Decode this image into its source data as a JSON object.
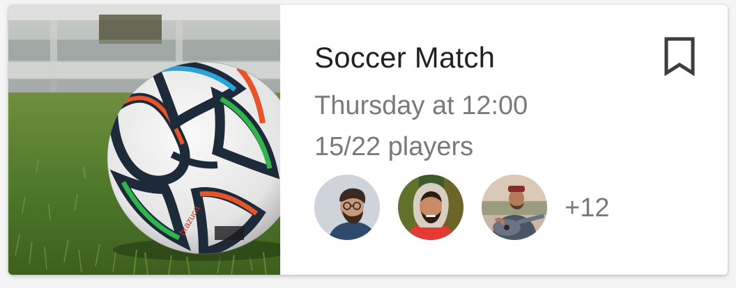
{
  "event": {
    "title": "Soccer Match",
    "when": "Thursday at 12:00",
    "players": "15/22 players",
    "more_count": "+12"
  },
  "image": {
    "subject": "soccer-ball-on-grass"
  },
  "attendees": [
    {
      "icon": "person-glasses-avatar"
    },
    {
      "icon": "person-hood-avatar"
    },
    {
      "icon": "person-guitar-avatar"
    }
  ],
  "icons": {
    "bookmark": "bookmark-icon"
  },
  "colors": {
    "title": "#212121",
    "secondary": "#7a7a7a",
    "card": "#ffffff",
    "background": "#f4f4f4"
  }
}
